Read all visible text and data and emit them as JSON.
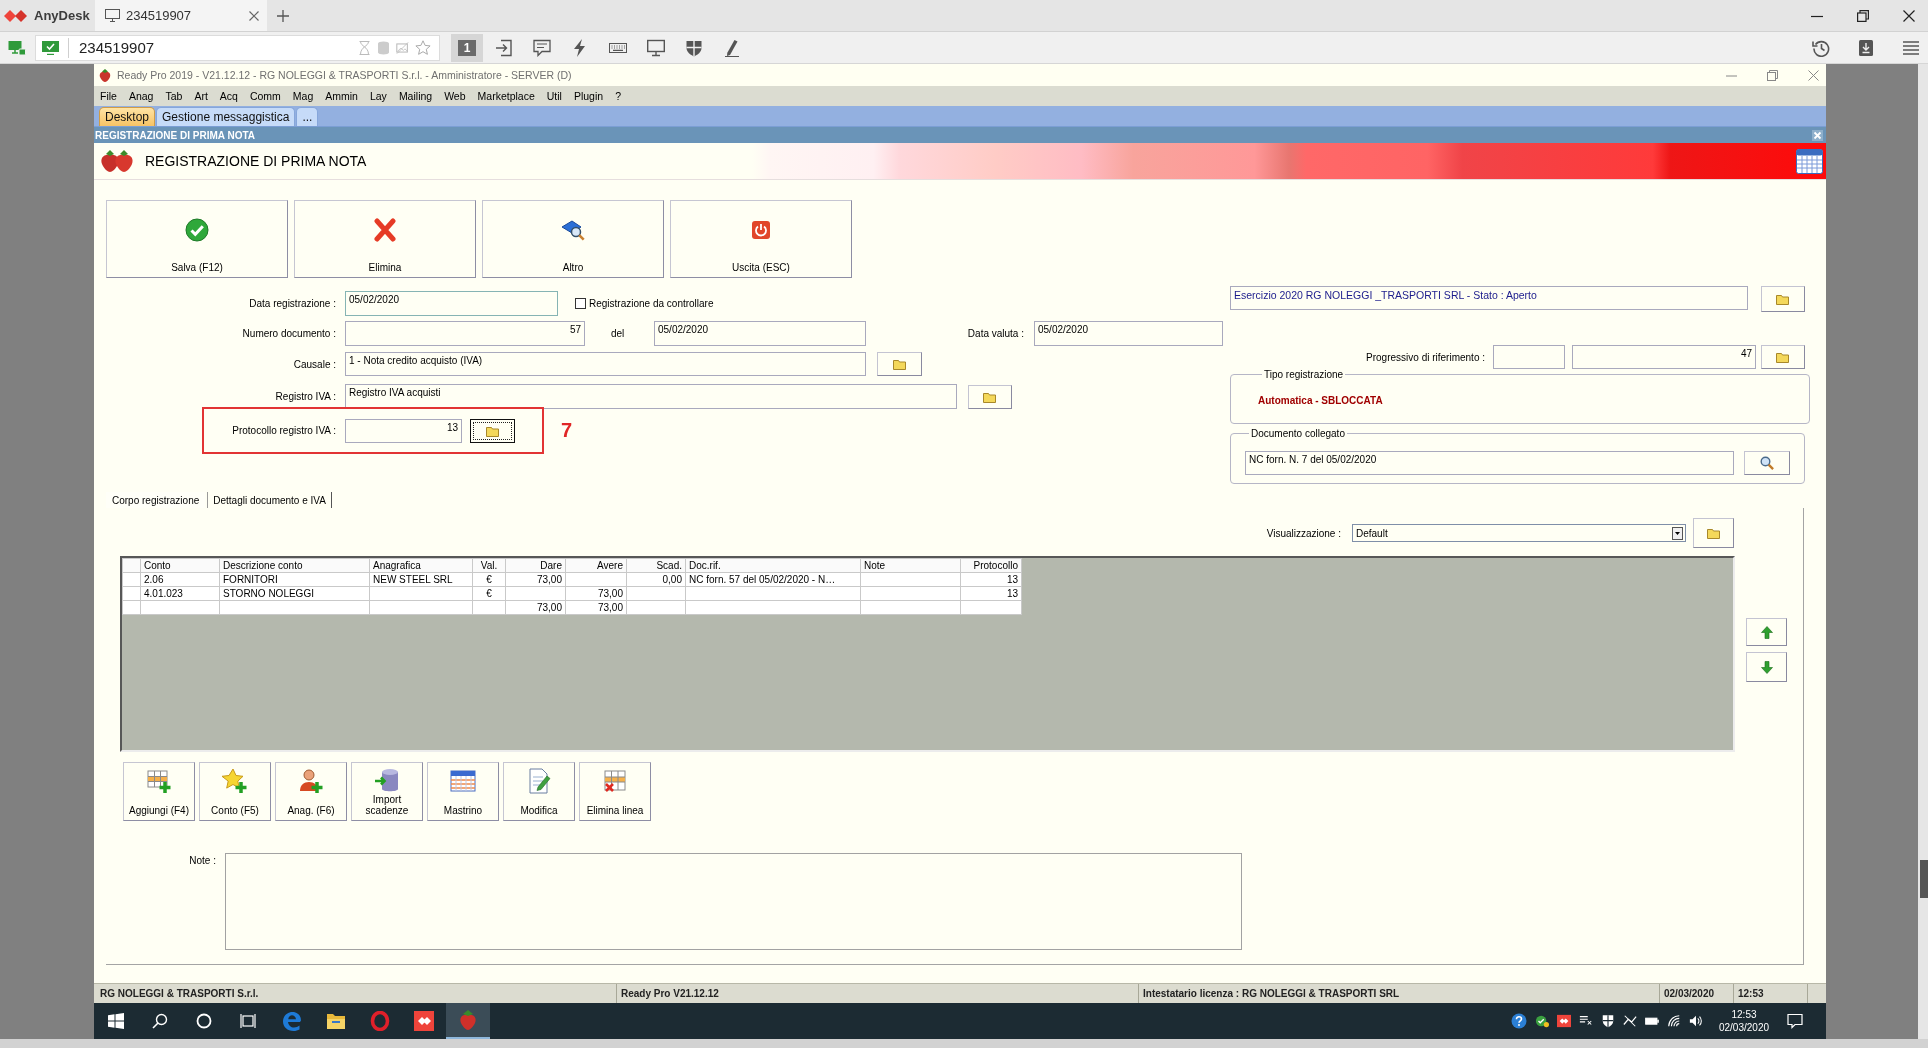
{
  "anydesk": {
    "brand": "AnyDesk",
    "session_tab": {
      "label": "234519907",
      "selected": true
    },
    "address": "234519907",
    "display_number": "1"
  },
  "window": {
    "title": "Ready Pro 2019 - V21.12.12 - RG NOLEGGI & TRASPORTI S.r.l. - Amministratore - SERVER (D)"
  },
  "menu": [
    "File",
    "Anag",
    "Tab",
    "Art",
    "Acq",
    "Comm",
    "Mag",
    "Ammin",
    "Lay",
    "Mailing",
    "Web",
    "Marketplace",
    "Util",
    "Plugin",
    "?"
  ],
  "doc_tabs": [
    {
      "label": "Desktop",
      "selected": true
    },
    {
      "label": "Gestione messaggistica",
      "selected": false
    },
    {
      "label": "...",
      "selected": false
    }
  ],
  "section_header": "REGISTRAZIONE DI PRIMA NOTA",
  "page_title": "REGISTRAZIONE DI PRIMA NOTA",
  "actions": [
    {
      "label": "Salva (F12)",
      "kind": "save"
    },
    {
      "label": "Elimina",
      "kind": "delete"
    },
    {
      "label": "Altro",
      "kind": "more"
    },
    {
      "label": "Uscita (ESC)",
      "kind": "exit"
    }
  ],
  "form": {
    "data_registrazione": {
      "label": "Data registrazione :",
      "value": "05/02/2020"
    },
    "da_controllare": {
      "label": "Registrazione da controllare",
      "checked": false
    },
    "numero_documento": {
      "label": "Numero documento :",
      "value": "57"
    },
    "del": {
      "label": "del",
      "value": "05/02/2020"
    },
    "data_valuta": {
      "label": "Data valuta :",
      "value": "05/02/2020"
    },
    "causale": {
      "label": "Causale :",
      "value": "1 - Nota credito acquisto (IVA)"
    },
    "registro_iva": {
      "label": "Registro IVA :",
      "value": "Registro IVA acquisti"
    },
    "protocollo": {
      "label": "Protocollo registro IVA :",
      "value": "13",
      "button_focused": true
    },
    "annotation": "7"
  },
  "side": {
    "esercizio": "Esercizio 2020 RG NOLEGGI _TRASPORTI SRL - Stato : Aperto",
    "progressivo": {
      "label": "Progressivo di riferimento :",
      "value": "47"
    },
    "tipo_registrazione": {
      "legend": "Tipo registrazione",
      "value": "Automatica - SBLOCCATA"
    },
    "documento_collegato": {
      "legend": "Documento collegato",
      "value": "NC forn. N. 7 del 05/02/2020"
    }
  },
  "body_tabs": [
    {
      "label": "Corpo registrazione",
      "selected": true
    },
    {
      "label": "Dettagli documento e IVA",
      "selected": false
    }
  ],
  "visualizzazione": {
    "label": "Visualizzazione :",
    "value": "Default"
  },
  "table": {
    "columns": [
      "Conto",
      "Descrizione conto",
      "Anagrafica",
      "Val.",
      "Dare",
      "Avere",
      "Scad.",
      "Doc.rif.",
      "Note",
      "Protocollo"
    ],
    "rows": [
      [
        "2.06",
        "FORNITORI",
        "NEW STEEL SRL",
        "€",
        "73,00",
        null,
        "0,00",
        "NC forn. 57 del 05/02/2020 - N…",
        null,
        "13"
      ],
      [
        "4.01.023",
        "STORNO NOLEGGI",
        null,
        "€",
        null,
        "73,00",
        null,
        null,
        null,
        "13"
      ],
      [
        null,
        null,
        null,
        null,
        "73,00",
        "73,00",
        null,
        null,
        null,
        null
      ]
    ]
  },
  "line_buttons": [
    {
      "label": "Aggiungi (F4)",
      "kind": "grid-add"
    },
    {
      "label": "Conto (F5)",
      "kind": "star-add"
    },
    {
      "label": "Anag. (F6)",
      "kind": "person-add"
    },
    {
      "label": "Import scadenze",
      "kind": "database"
    },
    {
      "label": "Mastrino",
      "kind": "calendar"
    },
    {
      "label": "Modifica",
      "kind": "edit"
    },
    {
      "label": "Elimina linea",
      "kind": "grid-delete"
    }
  ],
  "note": {
    "label": "Note :"
  },
  "status_bar": [
    "RG NOLEGGI & TRASPORTI S.r.l.",
    "Ready Pro V21.12.12",
    "Intestatario licenza : RG NOLEGGI & TRASPORTI SRL",
    "02/03/2020",
    "12:53"
  ],
  "taskbar": {
    "apps": [
      {
        "kind": "browser",
        "selected": false
      },
      {
        "kind": "folder",
        "selected": false
      },
      {
        "kind": "ring",
        "selected": false
      },
      {
        "kind": "diamond",
        "selected": false
      },
      {
        "kind": "strawberry",
        "selected": true
      }
    ],
    "time": "12:53",
    "date": "02/03/2020"
  }
}
